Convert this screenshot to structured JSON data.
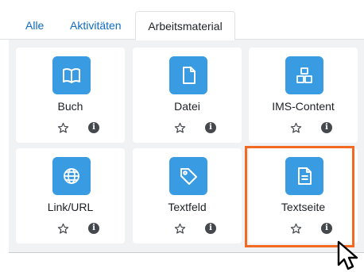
{
  "tabs": {
    "all": "Alle",
    "activities": "Aktivitäten",
    "resources": "Arbeitsmaterial"
  },
  "accent_color": "#399be2",
  "highlight_color": "#f26a21",
  "modules": [
    {
      "label": "Buch",
      "icon": "book-icon"
    },
    {
      "label": "Datei",
      "icon": "file-icon"
    },
    {
      "label": "IMS-Content",
      "icon": "package-icon"
    },
    {
      "label": "Link/URL",
      "icon": "globe-icon"
    },
    {
      "label": "Textfeld",
      "icon": "tag-icon"
    },
    {
      "label": "Textseite",
      "icon": "page-icon"
    }
  ],
  "info_glyph": "i"
}
